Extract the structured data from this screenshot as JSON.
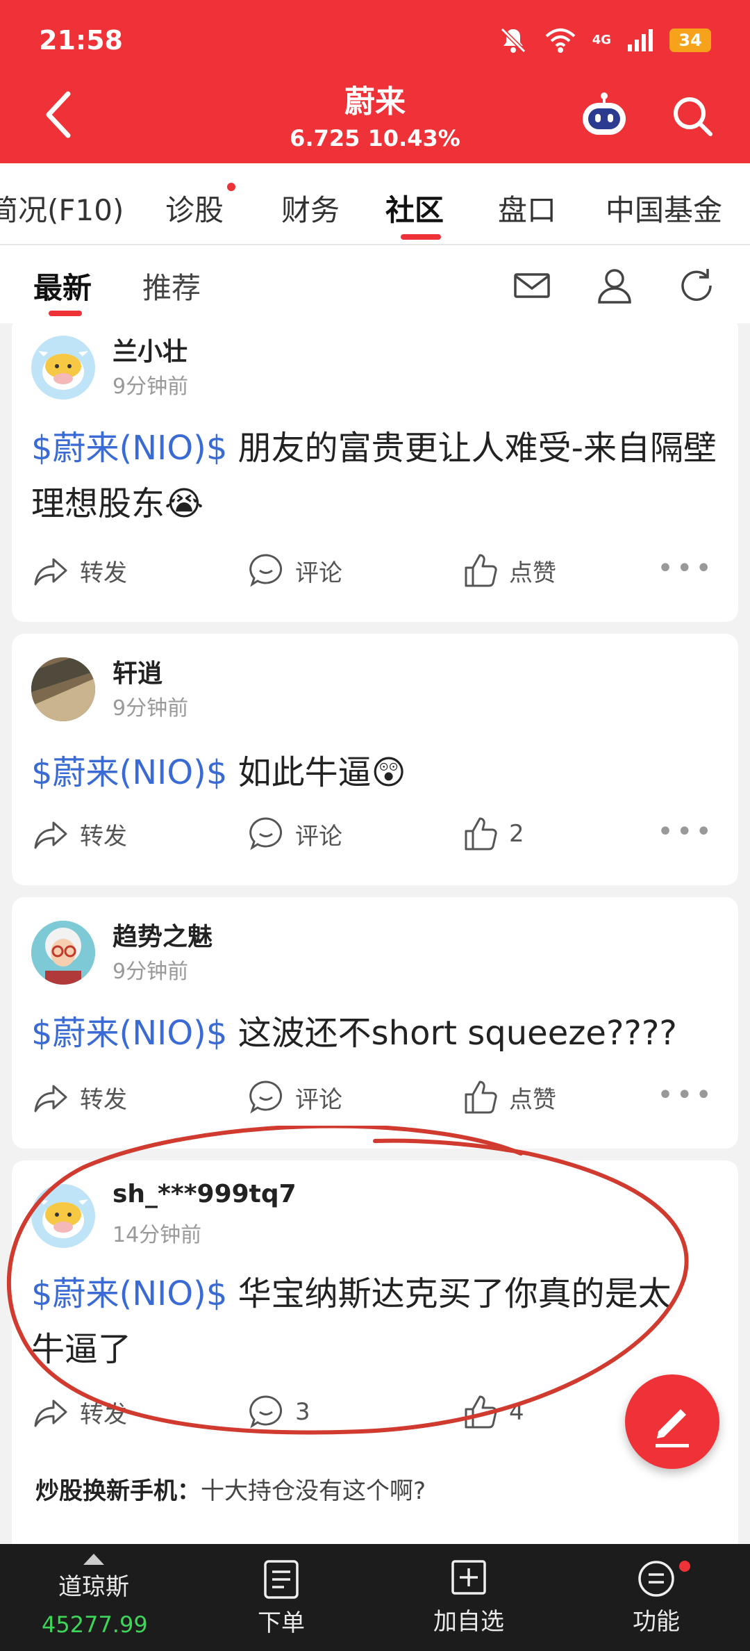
{
  "status": {
    "time": "21:58",
    "network": "4G",
    "battery": "34"
  },
  "header": {
    "title": "蔚来",
    "price": "6.725",
    "change": "10.43%"
  },
  "tabs": [
    {
      "label": "简况(F10)"
    },
    {
      "label": "诊股"
    },
    {
      "label": "财务"
    },
    {
      "label": "社区"
    },
    {
      "label": "盘口"
    },
    {
      "label": "中国基金"
    }
  ],
  "subtabs": [
    {
      "label": "最新"
    },
    {
      "label": "推荐"
    }
  ],
  "actions": {
    "repost": "转发",
    "comment": "评论",
    "like": "点赞"
  },
  "posts": [
    {
      "user": "兰小壮",
      "time": "9分钟前",
      "tag": "$蔚来(NIO)$",
      "text": " 朋友的富贵更让人难受-来自隔壁理想股东",
      "emoji": "😭",
      "comments": "评论",
      "likes": "点赞"
    },
    {
      "user": "轩逍",
      "time": "9分钟前",
      "tag": "$蔚来(NIO)$",
      "text": " 如此牛逼",
      "emoji": "😲",
      "comments": "评论",
      "likes": "2"
    },
    {
      "user": "趋势之魅",
      "time": "9分钟前",
      "tag": "$蔚来(NIO)$",
      "text": " 这波还不short squeeze????",
      "emoji": "",
      "comments": "评论",
      "likes": "点赞"
    },
    {
      "user": "sh_***999tq7",
      "time": "14分钟前",
      "tag": "$蔚来(NIO)$",
      "text": " 华宝纳斯达克买了你真的是太牛逼了",
      "emoji": "",
      "comments": "3",
      "likes": "4",
      "reply": {
        "user": "炒股换新手机：",
        "text": "十大持仓没有这个啊?"
      }
    }
  ],
  "bottom": {
    "index_name": "道琼斯",
    "index_value": "45277.99",
    "order": "下单",
    "watchlist": "加自选",
    "functions": "功能"
  },
  "colors": {
    "brand_red": "#ee3237",
    "link_blue": "#3a6bd4",
    "up_green": "#3ed65a"
  }
}
